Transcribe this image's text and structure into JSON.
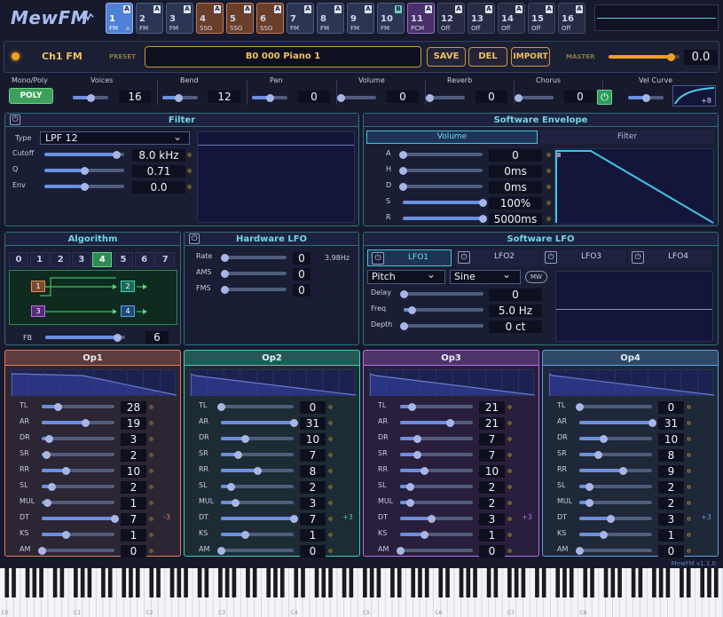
{
  "app": {
    "title": "MewFM",
    "version": "MewFM v1.1.0"
  },
  "channels": [
    {
      "num": "1",
      "type": "FM",
      "flag": "A",
      "active": true,
      "tone": "fm"
    },
    {
      "num": "2",
      "type": "FM",
      "flag": "A",
      "tone": "fm"
    },
    {
      "num": "3",
      "type": "FM",
      "flag": "A",
      "tone": "fm"
    },
    {
      "num": "4",
      "type": "SSG",
      "flag": "A",
      "tone": "ssg"
    },
    {
      "num": "5",
      "type": "SSG",
      "flag": "A",
      "tone": "ssg"
    },
    {
      "num": "6",
      "type": "SSG",
      "flag": "A",
      "tone": "ssg"
    },
    {
      "num": "7",
      "type": "FM",
      "flag": "A",
      "tone": "fm"
    },
    {
      "num": "8",
      "type": "FM",
      "flag": "A",
      "tone": "fm"
    },
    {
      "num": "9",
      "type": "FM",
      "flag": "A",
      "tone": "fm"
    },
    {
      "num": "10",
      "type": "FM",
      "flag": "B",
      "tone": "fm"
    },
    {
      "num": "11",
      "type": "PCM",
      "flag": "A",
      "tone": "pcm"
    },
    {
      "num": "12",
      "type": "Off",
      "flag": "A",
      "tone": "off"
    },
    {
      "num": "13",
      "type": "Off",
      "flag": "A",
      "tone": "off"
    },
    {
      "num": "14",
      "type": "Off",
      "flag": "A",
      "tone": "off"
    },
    {
      "num": "15",
      "type": "Off",
      "flag": "A",
      "tone": "off"
    },
    {
      "num": "16",
      "type": "Off",
      "flag": "A",
      "tone": "off"
    }
  ],
  "preset_bar": {
    "channel": "Ch1 FM",
    "preset_label": "PRESET",
    "preset_name": "B0 000 Piano 1",
    "save": "SAVE",
    "del": "DEL",
    "import": "IMPORT",
    "master_label": "MASTER",
    "master_value": "0.0",
    "master_level": 0.88
  },
  "global": [
    {
      "label": "Voices",
      "value": "16",
      "level": 0.5
    },
    {
      "label": "Bend",
      "value": "12",
      "level": 0.45
    },
    {
      "label": "Pan",
      "value": "0",
      "level": 0.5
    },
    {
      "label": "Volume",
      "value": "0",
      "level": 0.0
    },
    {
      "label": "Reverb",
      "value": "0",
      "level": 0.0
    },
    {
      "label": "Chorus",
      "value": "0",
      "level": 0.0
    },
    {
      "label": "Vel Curve",
      "value": "",
      "level": 0.5
    }
  ],
  "mono_poly": {
    "label": "Mono/Poly",
    "button": "POLY"
  },
  "vel_curve_value": "+8",
  "filter": {
    "title": "Filter",
    "type_label": "Type",
    "type_value": "LPF 12",
    "rows": [
      {
        "label": "Cutoff",
        "value": "8.0 kHz",
        "level": 0.9
      },
      {
        "label": "Q",
        "value": "0.71",
        "level": 0.5
      },
      {
        "label": "Env",
        "value": "0.0",
        "level": 0.5
      }
    ]
  },
  "sw_env": {
    "title": "Software Envelope",
    "tabs": [
      "Volume",
      "Filter"
    ],
    "rows": [
      {
        "label": "A",
        "value": "0",
        "level": 0.0
      },
      {
        "label": "H",
        "value": "0ms",
        "level": 0.0
      },
      {
        "label": "D",
        "value": "0ms",
        "level": 0.0
      },
      {
        "label": "S",
        "value": "100%",
        "level": 1.0
      },
      {
        "label": "R",
        "value": "5000ms",
        "level": 1.0
      }
    ]
  },
  "algorithm": {
    "title": "Algorithm",
    "tabs": [
      "0",
      "1",
      "2",
      "3",
      "4",
      "5",
      "6",
      "7"
    ],
    "selected": 4,
    "fb_label": "FB",
    "fb_value": "6",
    "fb_level": 0.9,
    "ops": [
      "1",
      "2",
      "3",
      "4"
    ]
  },
  "hw_lfo": {
    "title": "Hardware LFO",
    "rows": [
      {
        "label": "Rate",
        "value": "0",
        "level": 0.0
      },
      {
        "label": "AMS",
        "value": "0",
        "level": 0.0
      },
      {
        "label": "FMS",
        "value": "0",
        "level": 0.0
      }
    ],
    "rate_hz": "3.98Hz"
  },
  "sw_lfo": {
    "title": "Software LFO",
    "tabs": [
      "LFO1",
      "LFO2",
      "LFO3",
      "LFO4"
    ],
    "target": "Pitch",
    "shape": "Sine",
    "mw": "MW",
    "rows": [
      {
        "label": "Delay",
        "value": "0",
        "level": 0.0
      },
      {
        "label": "Freq",
        "value": "5.0 Hz",
        "level": 0.1
      },
      {
        "label": "Depth",
        "value": "0 ct",
        "level": 0.0
      }
    ]
  },
  "op_labels": [
    "TL",
    "AR",
    "DR",
    "SR",
    "RR",
    "SL",
    "MUL",
    "DT",
    "KS",
    "AM"
  ],
  "ops": [
    {
      "title": "Op1",
      "values": [
        "28",
        "19",
        "3",
        "2",
        "10",
        "2",
        "1",
        "7",
        "1",
        "0"
      ],
      "levels": [
        0.22,
        0.6,
        0.1,
        0.06,
        0.33,
        0.13,
        0.07,
        1.0,
        0.33,
        0.0
      ],
      "dt": "-3",
      "color": "#e07a55"
    },
    {
      "title": "Op2",
      "values": [
        "0",
        "31",
        "10",
        "7",
        "8",
        "2",
        "3",
        "7",
        "1",
        "0"
      ],
      "levels": [
        0.0,
        1.0,
        0.33,
        0.23,
        0.5,
        0.13,
        0.2,
        1.0,
        0.33,
        0.0
      ],
      "dt": "+3",
      "color": "#3ad0b4"
    },
    {
      "title": "Op3",
      "values": [
        "21",
        "21",
        "7",
        "7",
        "10",
        "2",
        "2",
        "3",
        "1",
        "0"
      ],
      "levels": [
        0.16,
        0.68,
        0.23,
        0.23,
        0.33,
        0.13,
        0.13,
        0.43,
        0.33,
        0.0
      ],
      "dt": "+3",
      "color": "#b66ee6"
    },
    {
      "title": "Op4",
      "values": [
        "0",
        "31",
        "10",
        "8",
        "9",
        "2",
        "2",
        "3",
        "1",
        "0"
      ],
      "levels": [
        0.0,
        1.0,
        0.33,
        0.26,
        0.6,
        0.13,
        0.13,
        0.43,
        0.33,
        0.0
      ],
      "dt": "+3",
      "color": "#5ca0e0"
    }
  ],
  "keyboard": {
    "octaves": [
      "C0",
      "C1",
      "C2",
      "C3",
      "C4",
      "C5",
      "C6",
      "C7",
      "C8"
    ]
  }
}
